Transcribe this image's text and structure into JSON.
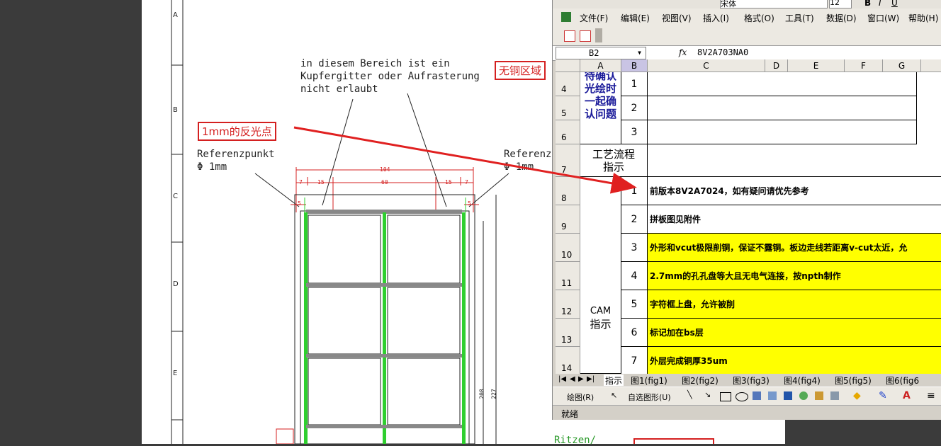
{
  "drawing": {
    "annotation_german": [
      "in diesem Bereich ist ein",
      "Kupfergitter oder Aufrasterung",
      "nicht erlaubt"
    ],
    "copper_free_label": "无铜区域",
    "reflect_point_label": "1mm的反光点",
    "ref_left": [
      "Referenzpunkt",
      "Φ 1mm"
    ],
    "ref_right": [
      "Referenz",
      "Φ 1mm"
    ],
    "row_letters": [
      "A",
      "B",
      "C",
      "D",
      "E"
    ],
    "dims": {
      "top": "104",
      "left_a": "7",
      "left_b": "15",
      "mid": "60",
      "right_b": "15",
      "right_a": "7",
      "side": "5",
      "side2": "5",
      "h1": "208",
      "h2": "227"
    },
    "bottom_green": "Ritzen/"
  },
  "excel": {
    "title_partial": "宋体",
    "font_size": "12",
    "menu": [
      "文件(F)",
      "编辑(E)",
      "视图(V)",
      "插入(I)",
      "格式(O)",
      "工具(T)",
      "数据(D)",
      "窗口(W)",
      "帮助(H)"
    ],
    "name_box": "B2",
    "fx": "fx",
    "formula_value": "8V2A703NA0",
    "columns": [
      "A",
      "B",
      "C",
      "D",
      "E",
      "F",
      "G"
    ],
    "rows": [
      "4",
      "5",
      "6",
      "7",
      "8",
      "9",
      "10",
      "11",
      "12",
      "13",
      "14"
    ],
    "label_confirm": [
      "待确认",
      "光绘时",
      "一起确",
      "认问题"
    ],
    "confirm_nums": [
      "1",
      "2",
      "3"
    ],
    "label_process": [
      "工艺流程",
      "指示"
    ],
    "label_cam": [
      "CAM",
      "指示"
    ],
    "instructions": [
      {
        "num": "1",
        "text": "前版本8V2A7024，如有疑问请优先参考",
        "yellow": false
      },
      {
        "num": "2",
        "text": "拼板图见附件",
        "yellow": false
      },
      {
        "num": "3",
        "text": "外形和vcut极限削铜，保证不露铜。板边走线若距离v-cut太近，允",
        "yellow": true
      },
      {
        "num": "4",
        "text": "2.7mm的孔孔盘等大且无电气连接，按npth制作",
        "yellow": true
      },
      {
        "num": "5",
        "text": "字符框上盘，允许被削",
        "yellow": true
      },
      {
        "num": "6",
        "text": "标记加在bs层",
        "yellow": true
      },
      {
        "num": "7",
        "text": "外层完成铜厚35um",
        "yellow": true
      }
    ],
    "tabs": [
      "指示",
      "图1(fig1)",
      "图2(fig2)",
      "图3(fig3)",
      "图4(fig4)",
      "图5(fig5)",
      "图6(fig6"
    ],
    "draw_toolbar": {
      "draw": "绘图(R)",
      "autoshape": "自选图形(U)"
    },
    "status": "就绪"
  }
}
